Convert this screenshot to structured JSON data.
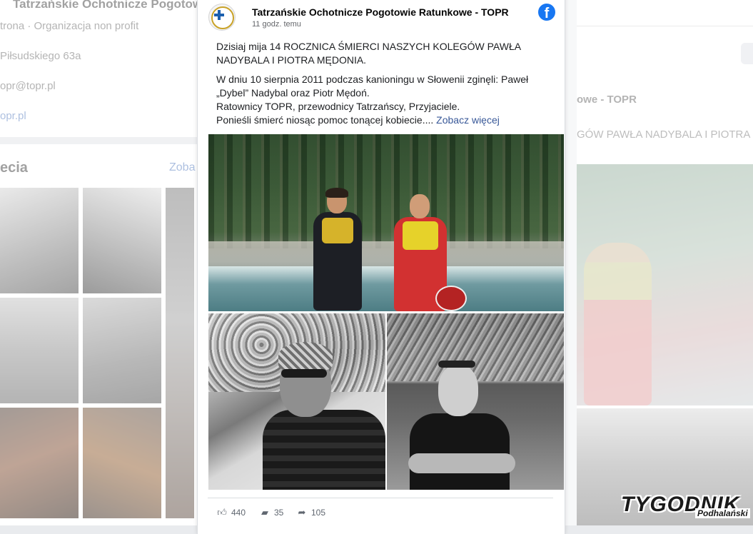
{
  "background": {
    "page_title": "Tatrzańskie Ochotnicze Pogotowie Ratunkowe - TOPR",
    "page_category": "trona · Organizacja non profit",
    "address": "Piłsudskiego 63a",
    "email": "opr@topr.pl",
    "website": "opr.pl",
    "photos_title": "ecia",
    "photos_more": "Zoba",
    "right_author": "owe - TOPR",
    "right_snippet": "GÓW PAWŁA NADYBALA I PIOTRA MĘ"
  },
  "post": {
    "page_name": "Tatrzańskie Ochotnicze Pogotowie Ratunkowe - TOPR",
    "time": "11 godz. temu",
    "paragraph1": "Dzisiaj mija 14 ROCZNICA ŚMIERCI NASZYCH KOLEGÓW PAWŁA NADYBALA I PIOTRA MĘDONIA.",
    "line1": "W dniu 10 sierpnia 2011 podczas kanioningu w Słowenii zginęli: Paweł „Dybel” Nadybal oraz Piotr Mędoń.",
    "line2": "Ratownicy TOPR, przewodnicy Tatrzańscy, Przyjaciele.",
    "line3": "Ponieśli śmierć niosąc pomoc tonącej kobiecie....",
    "see_more": "Zobacz więcej",
    "likes": "440",
    "comments": "35",
    "shares": "105"
  },
  "icons": {
    "facebook": "facebook-icon",
    "like": "thumbs-up-icon",
    "comment": "comment-icon",
    "share": "share-arrow-icon"
  },
  "watermark": {
    "word": "TYGODNIK",
    "sub": "Podhalański"
  },
  "colors": {
    "facebook_blue": "#1877f2",
    "link": "#385898"
  }
}
